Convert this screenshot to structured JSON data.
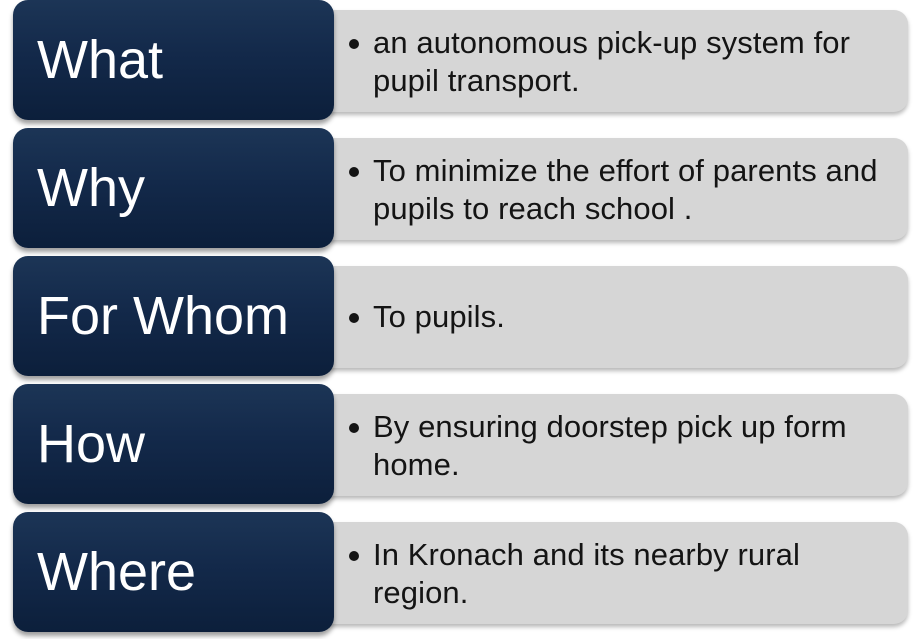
{
  "rows": [
    {
      "label": "What",
      "text": "an autonomous pick-up system for pupil transport."
    },
    {
      "label": "Why",
      "text": "To minimize the effort of parents and pupils to reach school ."
    },
    {
      "label": "For Whom",
      "text": "To pupils."
    },
    {
      "label": "How",
      "text": "By ensuring doorstep pick up form home."
    },
    {
      "label": "Where",
      "text": "In Kronach and its nearby rural region."
    }
  ],
  "colors": {
    "label_bg": "#13294a",
    "detail_bg": "#d6d6d6",
    "label_text": "#ffffff",
    "detail_text": "#141414"
  }
}
